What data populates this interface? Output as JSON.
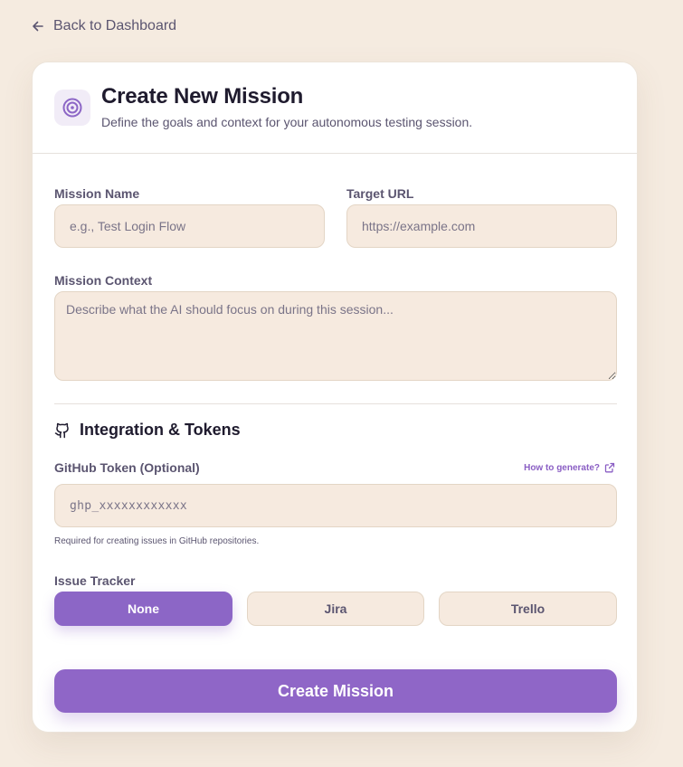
{
  "nav": {
    "back_label": "Back to Dashboard"
  },
  "header": {
    "title": "Create New Mission",
    "subtitle": "Define the goals and context for your autonomous testing session."
  },
  "form": {
    "mission_name": {
      "label": "Mission Name",
      "placeholder": "e.g., Test Login Flow",
      "value": ""
    },
    "target_url": {
      "label": "Target URL",
      "placeholder": "https://example.com",
      "value": ""
    },
    "mission_context": {
      "label": "Mission Context",
      "placeholder": "Describe what the AI should focus on during this session...",
      "value": ""
    }
  },
  "integration": {
    "title": "Integration & Tokens",
    "github_token": {
      "label": "GitHub Token (Optional)",
      "placeholder": "ghp_xxxxxxxxxxxx",
      "help_link": "How to generate?",
      "helper": "Required for creating issues in GitHub repositories."
    },
    "issue_tracker": {
      "label": "Issue Tracker",
      "options": [
        "None",
        "Jira",
        "Trello"
      ],
      "selected": "None"
    }
  },
  "submit_label": "Create Mission",
  "colors": {
    "background": "#f5ebe0",
    "accent": "#8f66c7",
    "field_bg": "#f6eadf",
    "text": "#1f1b2e",
    "muted": "#5b5570"
  },
  "icons": {
    "back": "arrow-left-icon",
    "header": "target-icon",
    "integration": "github-icon",
    "external": "external-link-icon"
  }
}
